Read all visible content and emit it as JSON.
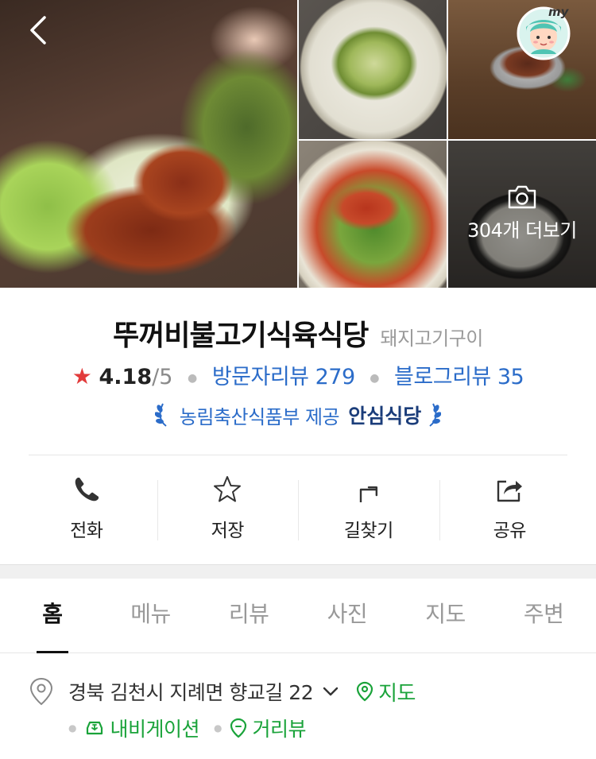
{
  "gallery": {
    "photo_count_label": "304개 더보기",
    "icons": {
      "back": "chevron-left-icon",
      "camera": "camera-icon",
      "profile": "my-avatar-icon"
    },
    "avatar_badge": "my"
  },
  "place": {
    "name": "뚜꺼비불고기식육식당",
    "category": "돼지고기구이",
    "rating": "4.18",
    "rating_max": "/5",
    "visitor_reviews": "방문자리뷰 279",
    "blog_reviews": "블로그리뷰 35",
    "certification_prefix": "농림축산식품부 제공",
    "certification_name": "안심식당"
  },
  "actions": [
    {
      "label": "전화",
      "icon": "phone-icon"
    },
    {
      "label": "저장",
      "icon": "star-icon"
    },
    {
      "label": "길찾기",
      "icon": "directions-icon"
    },
    {
      "label": "공유",
      "icon": "share-icon"
    }
  ],
  "tabs": [
    {
      "label": "홈",
      "active": true
    },
    {
      "label": "메뉴",
      "active": false
    },
    {
      "label": "리뷰",
      "active": false
    },
    {
      "label": "사진",
      "active": false
    },
    {
      "label": "지도",
      "active": false
    },
    {
      "label": "주변",
      "active": false
    }
  ],
  "address": {
    "text": "경북 김천시 지례면 향교길 22",
    "map_link": "지도",
    "navigation_link": "내비게이션",
    "street_view_link": "거리뷰"
  },
  "colors": {
    "accent_blue": "#2b6cc9",
    "star_red": "#e23b3b",
    "link_green": "#1aa33a"
  }
}
